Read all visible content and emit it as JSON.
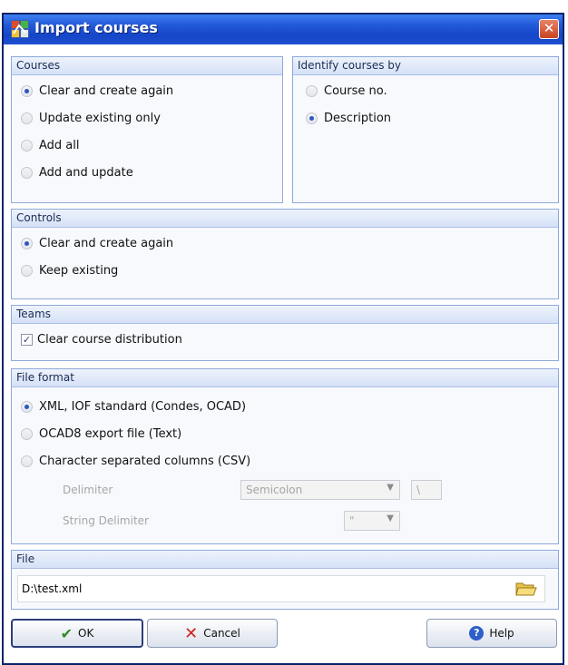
{
  "window": {
    "title": "Import courses",
    "close_glyph": "✕"
  },
  "courses": {
    "header": "Courses",
    "options": [
      {
        "label": "Clear and create again",
        "selected": true
      },
      {
        "label": "Update existing only",
        "selected": false
      },
      {
        "label": "Add all",
        "selected": false
      },
      {
        "label": "Add and update",
        "selected": false
      }
    ]
  },
  "identify": {
    "header": "Identify courses by",
    "options": [
      {
        "label": "Course no.",
        "selected": false
      },
      {
        "label": "Description",
        "selected": true
      }
    ]
  },
  "controls": {
    "header": "Controls",
    "options": [
      {
        "label": "Clear and create again",
        "selected": true
      },
      {
        "label": "Keep existing",
        "selected": false
      }
    ]
  },
  "teams": {
    "header": "Teams",
    "checkbox_label": "Clear course distribution",
    "checked": true
  },
  "file_format": {
    "header": "File format",
    "options": [
      {
        "label": "XML, IOF standard (Condes, OCAD)",
        "selected": true
      },
      {
        "label": "OCAD8 export file (Text)",
        "selected": false
      },
      {
        "label": "Character separated columns (CSV)",
        "selected": false
      }
    ],
    "delimiter_label": "Delimiter",
    "delimiter_value": "Semicolon",
    "delimiter_extra": "\\",
    "string_delimiter_label": "String Delimiter",
    "string_delimiter_value": "\""
  },
  "file": {
    "header": "File",
    "path": "D:\\test.xml"
  },
  "buttons": {
    "ok": "OK",
    "cancel": "Cancel",
    "help": "Help"
  },
  "icons": {
    "ok": "check-icon",
    "cancel": "x-icon",
    "help": "help-icon",
    "browse": "folder-icon",
    "app": "app-icon"
  },
  "colors": {
    "title_bar": "#2359d8",
    "panel_border": "#8eaad8",
    "selected_radio": "#2a56c6"
  }
}
